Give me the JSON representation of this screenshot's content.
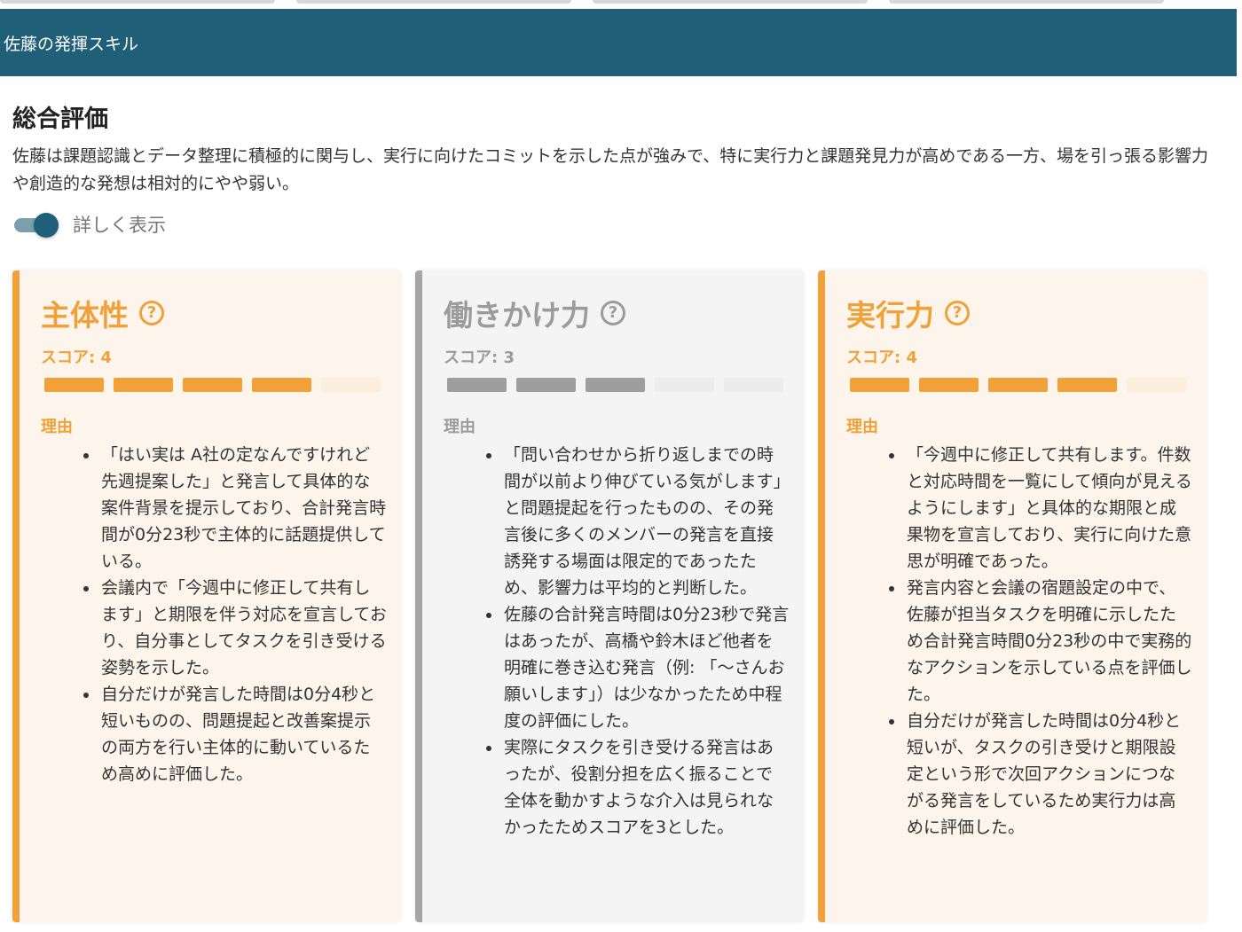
{
  "header": {
    "title": "佐藤の発揮スキル"
  },
  "summary": {
    "heading": "総合評価",
    "text": "佐藤は課題認識とデータ整理に積極的に関与し、実行に向けたコミットを示した点が強みで、特に実行力と課題発見力が高めである一方、場を引っ張る影響力や創造的な発想は相対的にやや弱い。"
  },
  "toggle": {
    "label": "詳しく表示",
    "on": true
  },
  "cards": [
    {
      "title": "主体性",
      "score_label": "スコア: 4",
      "score": 4,
      "max_score": 5,
      "reason_label": "理由",
      "reasons": [
        "「はい実は A社の定なんですけれど先週提案した」と発言して具体的な案件背景を提示しており、合計発言時間が0分23秒で主体的に話題提供している。",
        "会議内で「今週中に修正して共有します」と期限を伴う対応を宣言しており、自分事としてタスクを引き受ける姿勢を示した。",
        "自分だけが発言した時間は0分4秒と短いものの、問題提起と改善案提示の両方を行い主体的に動いているため高めに評価した。"
      ]
    },
    {
      "title": "働きかけ力",
      "score_label": "スコア: 3",
      "score": 3,
      "max_score": 5,
      "reason_label": "理由",
      "reasons": [
        "「問い合わせから折り返しまでの時間が以前より伸びている気がします」と問題提起を行ったものの、その発言後に多くのメンバーの発言を直接誘発する場面は限定的であったため、影響力は平均的と判断した。",
        "佐藤の合計発言時間は0分23秒で発言はあったが、高橋や鈴木ほど他者を明確に巻き込む発言（例: 「〜さんお願いします」）は少なかったため中程度の評価にした。",
        "実際にタスクを引き受ける発言はあったが、役割分担を広く振ることで全体を動かすような介入は見られなかったためスコアを3とした。"
      ]
    },
    {
      "title": "実行力",
      "score_label": "スコア: 4",
      "score": 4,
      "max_score": 5,
      "reason_label": "理由",
      "reasons": [
        "「今週中に修正して共有します。件数と対応時間を一覧にして傾向が見えるようにします」と具体的な期限と成果物を宣言しており、実行に向けた意思が明確であった。",
        "発言内容と会議の宿題設定の中で、佐藤が担当タスクを明確に示したため合計発言時間0分23秒の中で実務的なアクションを示している点を評価した。",
        "自分だけが発言した時間は0分4秒と短いが、タスクの引き受けと期限設定という形で次回アクションにつながる発言をしているため実行力は高めに評価した。"
      ]
    }
  ],
  "colors": {
    "header_bg": "#1f5f78",
    "accent_orange": "#f0a13a",
    "muted_gray": "#9e9e9e"
  },
  "icons": {
    "help": "help-circle-icon",
    "help_glyph": "?"
  }
}
